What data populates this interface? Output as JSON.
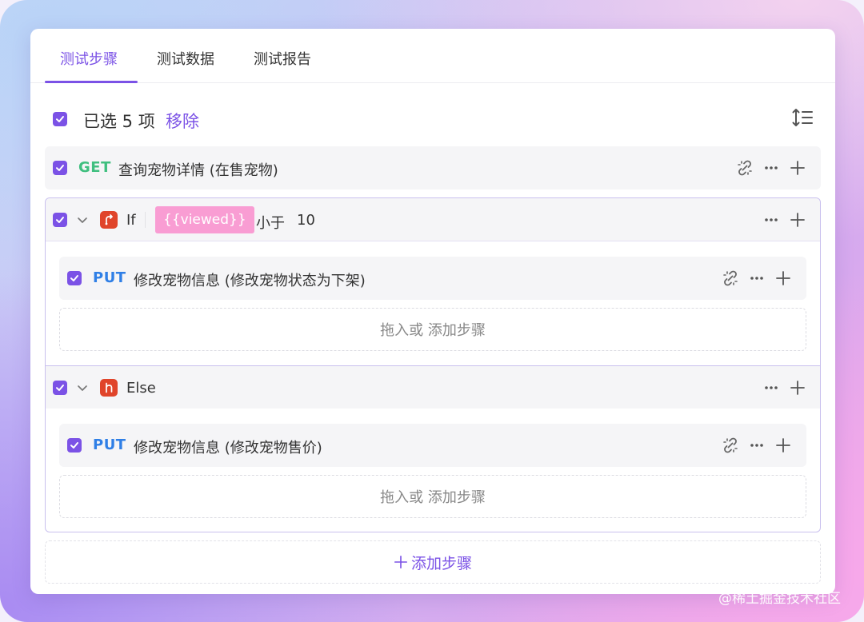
{
  "tabs": [
    {
      "label": "测试步骤",
      "active": true
    },
    {
      "label": "测试数据",
      "active": false
    },
    {
      "label": "测试报告",
      "active": false
    }
  ],
  "selection": {
    "text": "已选 5 项",
    "remove_label": "移除"
  },
  "steps": {
    "get_step": {
      "method": "GET",
      "name": "查询宠物详情 (在售宠物)"
    },
    "if_group": {
      "label": "If",
      "variable": "{{viewed}}",
      "condition": "小于",
      "value": "10",
      "child": {
        "method": "PUT",
        "name": "修改宠物信息 (修改宠物状态为下架)"
      },
      "dropzone": "拖入或 添加步骤"
    },
    "else_group": {
      "label": "Else",
      "child": {
        "method": "PUT",
        "name": "修改宠物信息 (修改宠物售价)"
      },
      "dropzone": "拖入或 添加步骤"
    }
  },
  "add_step_label": "添加步骤",
  "watermark": "@稀土掘金技术社区",
  "icons": {
    "checkbox": "check-icon",
    "sort": "line-height-icon",
    "link": "unlink-icon",
    "more": "more-icon",
    "plus": "plus-icon",
    "chevron": "chevron-down-icon",
    "if_branch": "branch-if-icon",
    "else_branch": "branch-else-icon"
  },
  "colors": {
    "accent": "#7b52e6",
    "get": "#3fbf7f",
    "put": "#2f7fe6",
    "branch": "#e0442a",
    "variable_chip": "#f99dd3"
  }
}
